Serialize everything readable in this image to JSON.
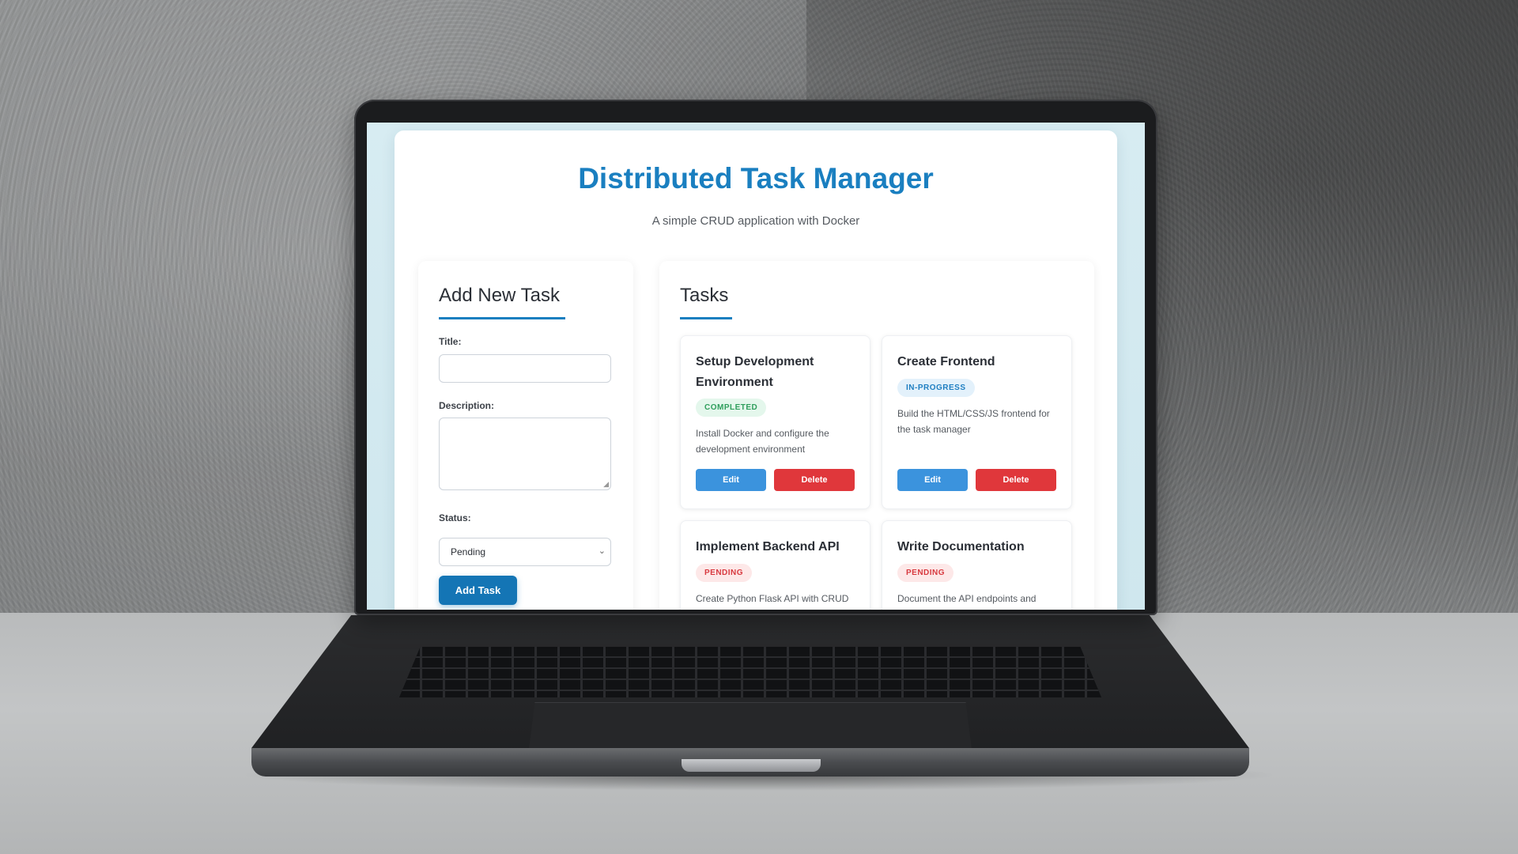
{
  "app": {
    "title": "Distributed Task Manager",
    "subtitle": "A simple CRUD application with Docker"
  },
  "form": {
    "heading": "Add New Task",
    "title_label": "Title:",
    "title_value": "",
    "description_label": "Description:",
    "description_value": "",
    "status_label": "Status:",
    "status_selected": "Pending",
    "submit_label": "Add Task"
  },
  "tasks_panel": {
    "heading": "Tasks",
    "tasks": [
      {
        "title": "Setup Development Environment",
        "status": "COMPLETED",
        "description": "Install Docker and configure the development environment",
        "edit_label": "Edit",
        "delete_label": "Delete"
      },
      {
        "title": "Create Frontend",
        "status": "IN-PROGRESS",
        "description": "Build the HTML/CSS/JS frontend for the task manager",
        "edit_label": "Edit",
        "delete_label": "Delete"
      },
      {
        "title": "Implement Backend API",
        "status": "PENDING",
        "description": "Create Python Flask API with CRUD"
      },
      {
        "title": "Write Documentation",
        "status": "PENDING",
        "description": "Document the API endpoints and"
      }
    ]
  },
  "colors": {
    "accent": "#1a7fc0",
    "completed": "#2f9e5c",
    "in_progress": "#1f7fc2",
    "pending": "#d8393f",
    "edit_button": "#3b93dd",
    "delete_button": "#e0373b"
  },
  "icons": {
    "select_arrow": "chevron-down-icon",
    "textarea_resize": "resize-grip-icon"
  }
}
